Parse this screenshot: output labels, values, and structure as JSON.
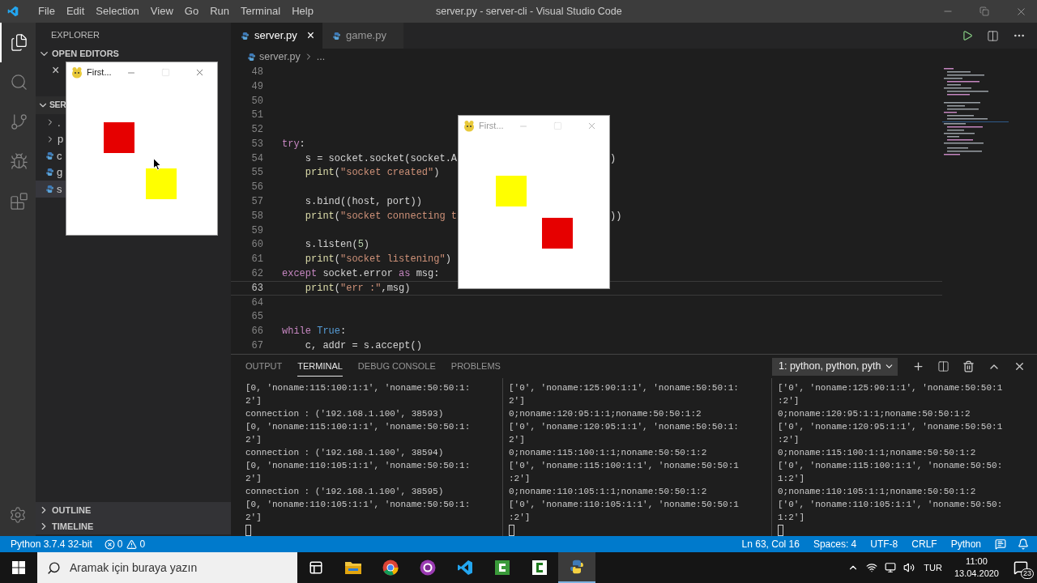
{
  "window": {
    "title": "server.py - server-cli - Visual Studio Code"
  },
  "menu": [
    "File",
    "Edit",
    "Selection",
    "View",
    "Go",
    "Run",
    "Terminal",
    "Help"
  ],
  "activity_bar": [
    {
      "selected": true
    },
    {
      "selected": false
    },
    {
      "selected": false
    },
    {
      "selected": false
    },
    {
      "selected": false
    }
  ],
  "sidebar": {
    "title": "EXPLORER",
    "open_editors": {
      "label": "OPEN EDITORS",
      "expanded": true,
      "items": [
        {
          "close": "×"
        }
      ]
    },
    "folder": {
      "label": "SER",
      "expanded": true,
      "items": [
        {
          "kind": "folder",
          "label": ".",
          "expanded": false,
          "selected": false
        },
        {
          "kind": "folder",
          "label": "p",
          "expanded": false,
          "selected": false
        },
        {
          "kind": "file",
          "label": "c",
          "selected": false
        },
        {
          "kind": "file",
          "label": "g",
          "selected": false
        },
        {
          "kind": "file",
          "label": "s",
          "selected": true
        }
      ]
    },
    "bottom_sections": [
      {
        "label": "OUTLINE",
        "expanded": false
      },
      {
        "label": "TIMELINE",
        "expanded": false
      }
    ]
  },
  "editor_tabs": [
    {
      "label": "server.py",
      "selected": true,
      "close": "×"
    },
    {
      "label": "game.py",
      "selected": false
    }
  ],
  "breadcrumb": [
    "server.py",
    "..."
  ],
  "code_lines": [
    {
      "n": "48",
      "current": false
    },
    {
      "n": "49",
      "current": false
    },
    {
      "n": "50",
      "current": false
    },
    {
      "n": "51",
      "current": false
    },
    {
      "n": "52",
      "current": false
    },
    {
      "n": "53",
      "current": false,
      "tokens": [
        {
          "kind": "keyword",
          "text": "try"
        },
        {
          "kind": "plain",
          "text": ":"
        }
      ]
    },
    {
      "n": "54",
      "current": false,
      "tokens": [
        {
          "kind": "plain",
          "text": "    s = socket.socket(socket.A"
        }
      ],
      "tail": ")"
    },
    {
      "n": "55",
      "current": false,
      "tokens": [
        {
          "kind": "func",
          "text": "    print"
        },
        {
          "kind": "plain",
          "text": "("
        },
        {
          "kind": "string",
          "text": "\"socket created\""
        },
        {
          "kind": "plain",
          "text": ")"
        }
      ]
    },
    {
      "n": "56",
      "current": false
    },
    {
      "n": "57",
      "current": false,
      "tokens": [
        {
          "kind": "plain",
          "text": "    s.bind((host, port))"
        }
      ]
    },
    {
      "n": "58",
      "current": false,
      "tokens": [
        {
          "kind": "func",
          "text": "    print"
        },
        {
          "kind": "plain",
          "text": "("
        },
        {
          "kind": "string",
          "text": "\"socket connecting t"
        }
      ],
      "tail": "))"
    },
    {
      "n": "59",
      "current": false
    },
    {
      "n": "60",
      "current": false,
      "tokens": [
        {
          "kind": "plain",
          "text": "    s.listen("
        },
        {
          "kind": "number",
          "text": "5"
        },
        {
          "kind": "plain",
          "text": ")"
        }
      ]
    },
    {
      "n": "61",
      "current": false,
      "tokens": [
        {
          "kind": "func",
          "text": "    print"
        },
        {
          "kind": "plain",
          "text": "("
        },
        {
          "kind": "string",
          "text": "\"socket listening\""
        },
        {
          "kind": "plain",
          "text": ")"
        }
      ]
    },
    {
      "n": "62",
      "current": false,
      "tokens": [
        {
          "kind": "keyword",
          "text": "except"
        },
        {
          "kind": "plain",
          "text": " socket.error "
        },
        {
          "kind": "keyword",
          "text": "as"
        },
        {
          "kind": "plain",
          "text": " msg:"
        }
      ]
    },
    {
      "n": "63",
      "current": true,
      "tokens": [
        {
          "kind": "func",
          "text": "    print"
        },
        {
          "kind": "plain",
          "text": "("
        },
        {
          "kind": "string",
          "text": "\"err :\""
        },
        {
          "kind": "plain",
          "text": ",msg)"
        }
      ]
    },
    {
      "n": "64",
      "current": false
    },
    {
      "n": "65",
      "current": false
    },
    {
      "n": "66",
      "current": false,
      "tokens": [
        {
          "kind": "keyword",
          "text": "while"
        },
        {
          "kind": "const",
          "text": " True"
        },
        {
          "kind": "plain",
          "text": ":"
        }
      ]
    },
    {
      "n": "67",
      "current": false,
      "tokens": [
        {
          "kind": "plain",
          "text": "    c, addr = s.accept()"
        }
      ]
    }
  ],
  "panel": {
    "tabs": [
      {
        "label": "OUTPUT",
        "selected": false
      },
      {
        "label": "TERMINAL",
        "selected": true
      },
      {
        "label": "DEBUG CONSOLE",
        "selected": false
      },
      {
        "label": "PROBLEMS",
        "selected": false
      }
    ],
    "terminal_select": "1: python, python, pyth",
    "terminals": [
      {
        "lines": [
          "[0, 'noname:115:100:1:1', 'noname:50:50:1:",
          "2']",
          "connection : ('192.168.1.100', 38593)",
          "[0, 'noname:115:100:1:1', 'noname:50:50:1:",
          "2']",
          "connection : ('192.168.1.100', 38594)",
          "[0, 'noname:110:105:1:1', 'noname:50:50:1:",
          "2']",
          "connection : ('192.168.1.100', 38595)",
          "[0, 'noname:110:105:1:1', 'noname:50:50:1:",
          "2']"
        ]
      },
      {
        "lines": [
          "['0', 'noname:125:90:1:1', 'noname:50:50:1:",
          "2']",
          "0;noname:120:95:1:1;noname:50:50:1:2",
          "['0', 'noname:120:95:1:1', 'noname:50:50:1:",
          "2']",
          "0;noname:115:100:1:1;noname:50:50:1:2",
          "['0', 'noname:115:100:1:1', 'noname:50:50:1",
          ":2']",
          "0;noname:110:105:1:1;noname:50:50:1:2",
          "['0', 'noname:110:105:1:1', 'noname:50:50:1",
          ":2']"
        ]
      },
      {
        "lines": [
          "['0', 'noname:125:90:1:1', 'noname:50:50:1",
          ":2']",
          "0;noname:120:95:1:1;noname:50:50:1:2",
          "['0', 'noname:120:95:1:1', 'noname:50:50:1",
          ":2']",
          "0;noname:115:100:1:1;noname:50:50:1:2",
          "['0', 'noname:115:100:1:1', 'noname:50:50:",
          "1:2']",
          "0;noname:110:105:1:1;noname:50:50:1:2",
          "['0', 'noname:110:105:1:1', 'noname:50:50:",
          "1:2']"
        ]
      }
    ]
  },
  "status_bar": {
    "interpreter": "Python 3.7.4 32-bit",
    "errors": "0",
    "warnings": "0",
    "right": [
      "Ln 63, Col 16",
      "Spaces: 4",
      "UTF-8",
      "CRLF",
      "Python"
    ]
  },
  "game_windows": [
    {
      "title": "First...",
      "squares": [
        {
          "color": "#e60000"
        },
        {
          "color": "#ffff00"
        }
      ]
    },
    {
      "title": "First...",
      "squares": [
        {
          "color": "#ffff00"
        },
        {
          "color": "#e60000"
        }
      ]
    }
  ],
  "taskbar": {
    "search": {
      "placeholder": "Aramak için buraya yazın"
    },
    "apps": [
      {
        "kind": "taskview",
        "active": false
      },
      {
        "kind": "folder",
        "active": false
      },
      {
        "kind": "browser",
        "active": false
      },
      {
        "kind": "purple",
        "active": false
      },
      {
        "kind": "vscode",
        "active": false
      },
      {
        "kind": "greenc",
        "active": false
      },
      {
        "kind": "whitec",
        "active": false
      },
      {
        "kind": "python",
        "active": true
      }
    ],
    "language": "TUR",
    "time": "11:00",
    "date": "13.04.2020",
    "notifications": "23"
  }
}
